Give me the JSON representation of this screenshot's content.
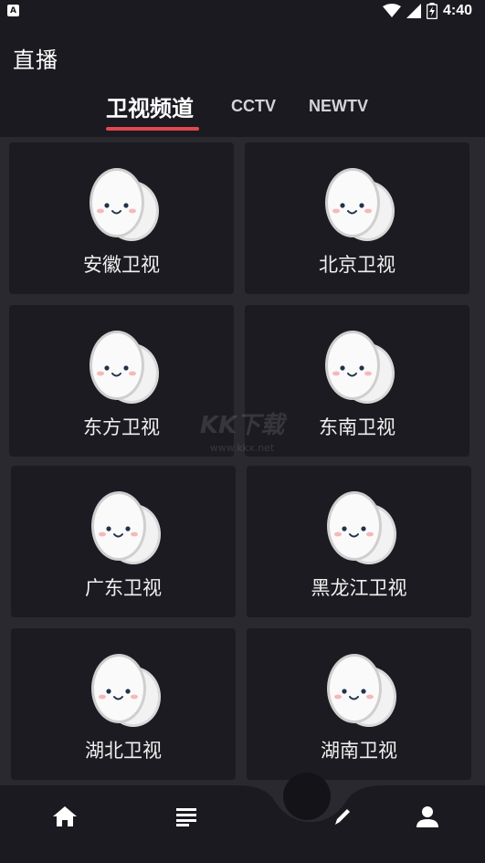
{
  "status_bar": {
    "notification_badge": "A",
    "time": "4:40",
    "icons": [
      "wifi-icon",
      "signal-icon",
      "battery-charging-icon"
    ]
  },
  "app": {
    "title": "直播"
  },
  "tabs": [
    {
      "label": "卫视频道",
      "active": true
    },
    {
      "label": "CCTV",
      "active": false
    },
    {
      "label": "NEWTV",
      "active": false
    }
  ],
  "channels": [
    {
      "name": "安徽卫视",
      "icon": "egg-mascot-icon"
    },
    {
      "name": "北京卫视",
      "icon": "egg-mascot-icon"
    },
    {
      "name": "东方卫视",
      "icon": "egg-mascot-icon"
    },
    {
      "name": "东南卫视",
      "icon": "egg-mascot-icon"
    },
    {
      "name": "广东卫视",
      "icon": "egg-mascot-icon"
    },
    {
      "name": "黑龙江卫视",
      "icon": "egg-mascot-icon"
    },
    {
      "name": "湖北卫视",
      "icon": "egg-mascot-icon"
    },
    {
      "name": "湖南卫视",
      "icon": "egg-mascot-icon"
    }
  ],
  "watermark": {
    "main": "KK下载",
    "sub": "www.kkx.net"
  },
  "bottom_nav": [
    {
      "icon": "home-icon"
    },
    {
      "icon": "list-icon"
    },
    {
      "icon": "edit-icon"
    },
    {
      "icon": "person-icon"
    }
  ],
  "colors": {
    "background": "#1b1a20",
    "card": "#1c1b21",
    "accent": "#e0484e",
    "text": "#ffffff"
  }
}
